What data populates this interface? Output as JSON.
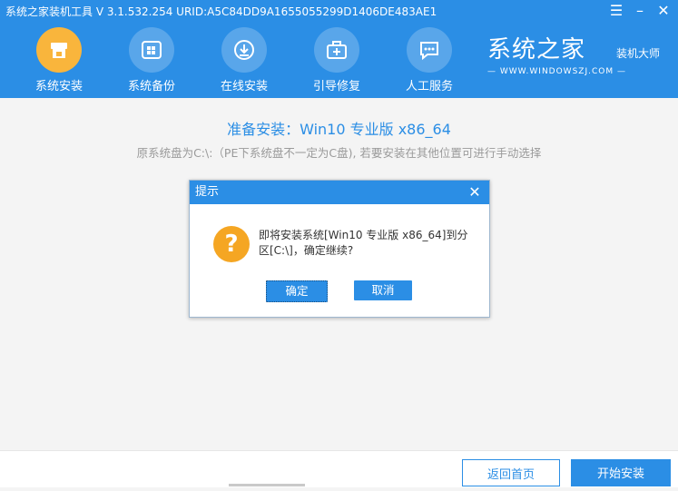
{
  "window": {
    "title": "系统之家装机工具 V 3.1.532.254 URID:A5C84DD9A1655055299D1406DE483AE1",
    "menu_icon": "menu-icon",
    "minimize_icon": "minimize-icon",
    "close_icon": "close-icon"
  },
  "nav": {
    "items": [
      {
        "label": "系统安装",
        "icon": "system-install-icon",
        "active": true
      },
      {
        "label": "系统备份",
        "icon": "system-backup-icon",
        "active": false
      },
      {
        "label": "在线安装",
        "icon": "online-install-icon",
        "active": false
      },
      {
        "label": "引导修复",
        "icon": "boot-repair-icon",
        "active": false
      },
      {
        "label": "人工服务",
        "icon": "chat-service-icon",
        "active": false
      }
    ]
  },
  "brand": {
    "name": "系统之家",
    "suffix": "装机大师",
    "url": "— WWW.WINDOWSZJ.COM —"
  },
  "main": {
    "title": "准备安装：Win10 专业版 x86_64",
    "subtitle": "原系统盘为C:\\:（PE下系统盘不一定为C盘), 若要安装在其他位置可进行手动选择"
  },
  "dialog": {
    "title": "提示",
    "message": "即将安装系统[Win10 专业版 x86_64]到分区[C:\\]，确定继续?",
    "ok_label": "确定",
    "cancel_label": "取消",
    "icon": "question-icon"
  },
  "footer": {
    "back_label": "返回首页",
    "start_label": "开始安装"
  },
  "colors": {
    "accent": "#2b8ee5",
    "active_nav": "#f9b53c",
    "warning": "#f5a623"
  }
}
